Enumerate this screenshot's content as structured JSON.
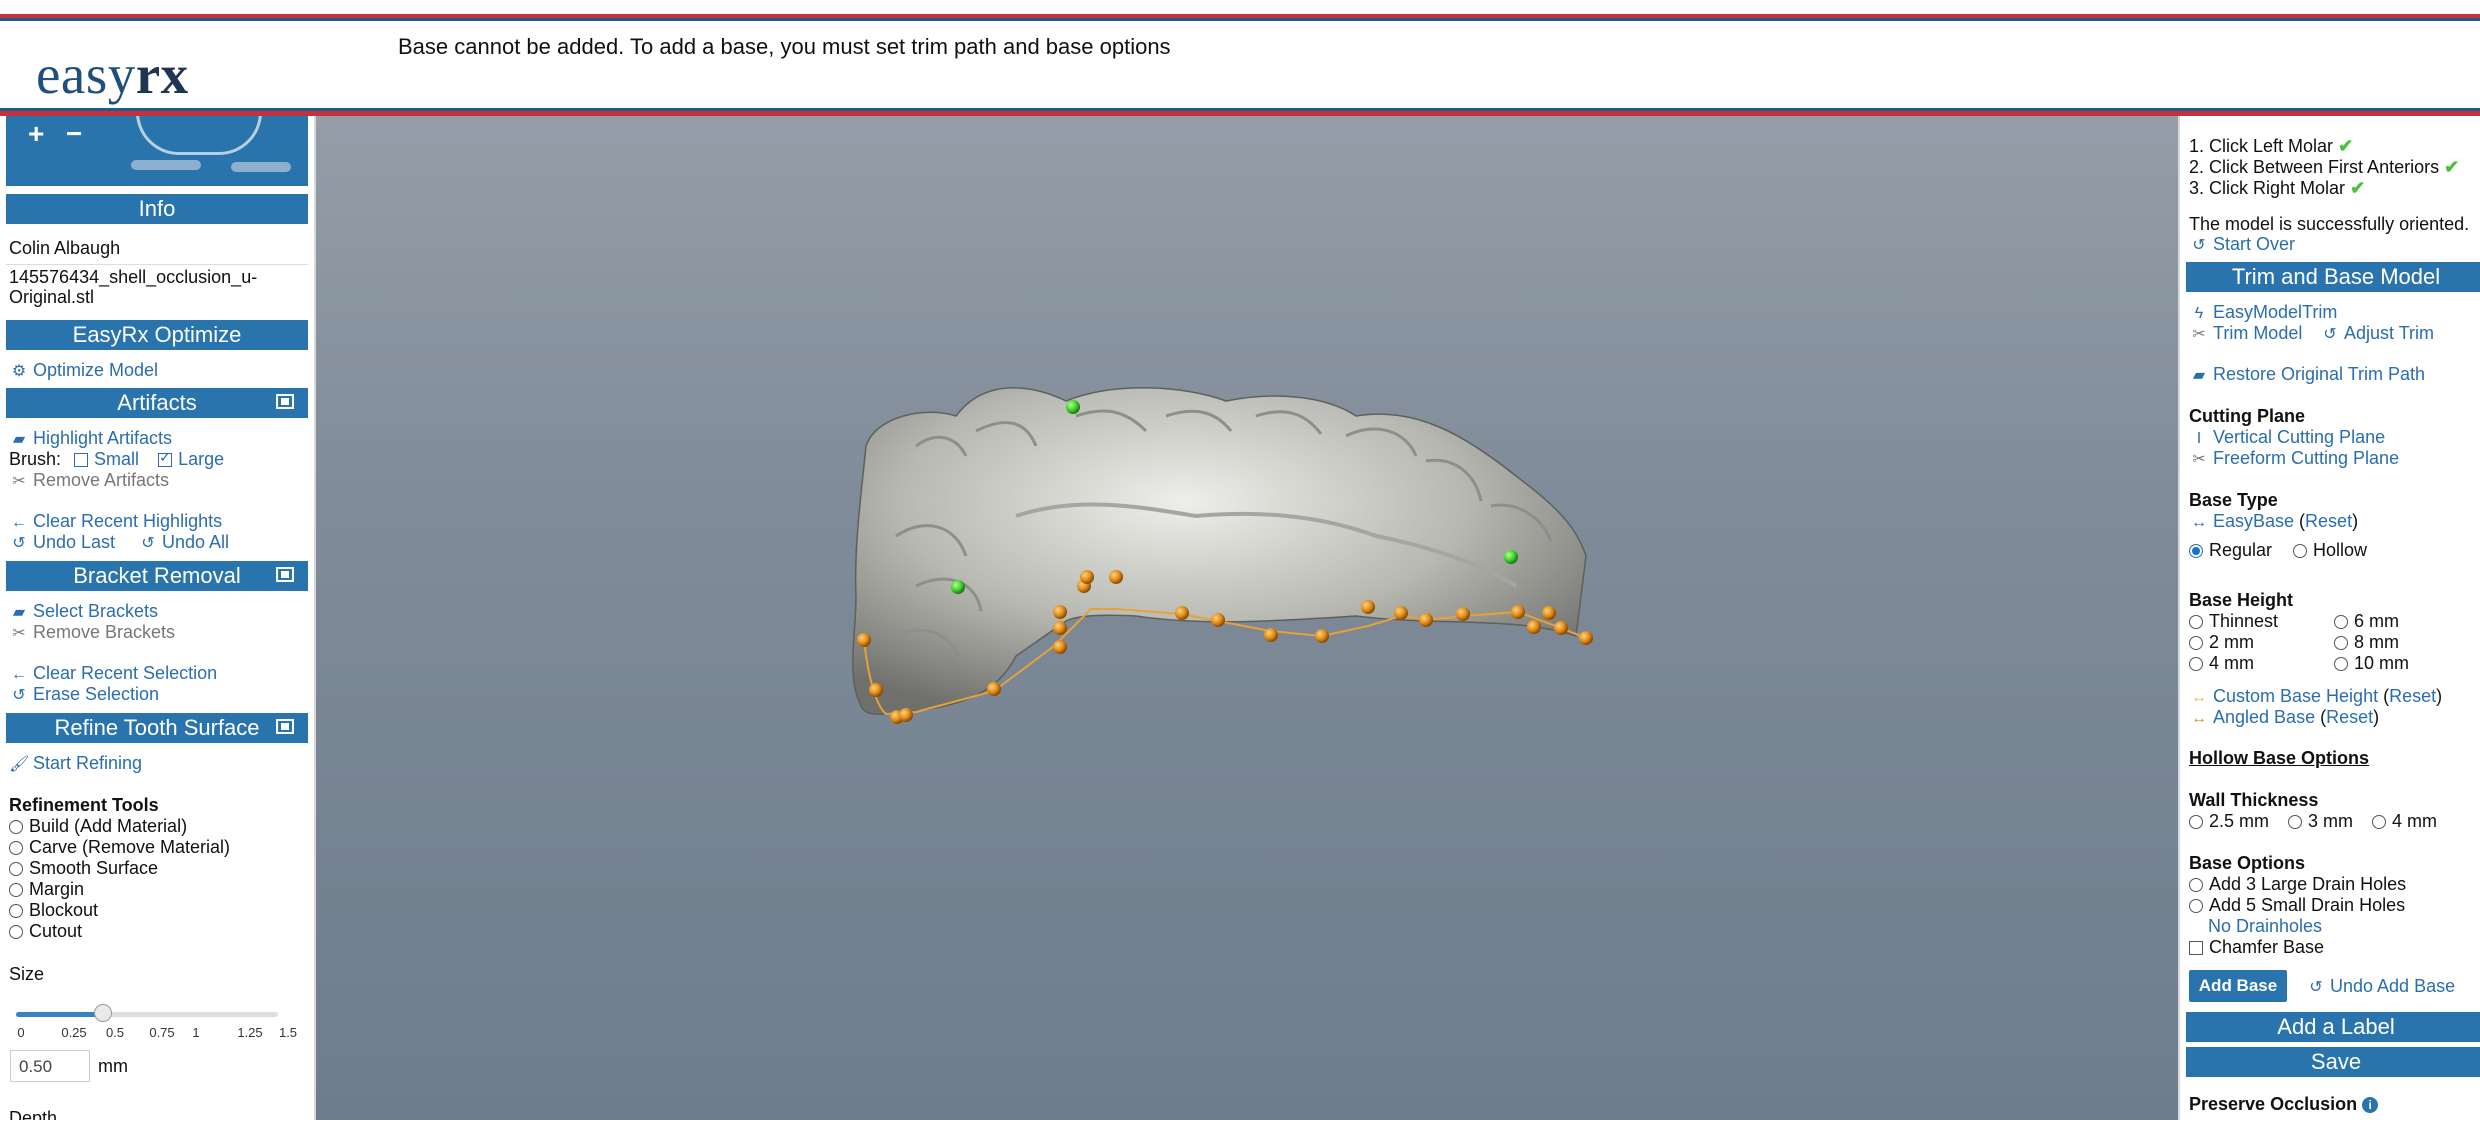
{
  "header": {
    "logo_easy": "easy",
    "logo_rx": "rx",
    "status_message": "Base cannot be added. To add a base, you must set trim path and base options"
  },
  "left": {
    "thumb_plus": "+",
    "thumb_minus": "−",
    "info_header": "Info",
    "patient_name": "Colin Albaugh",
    "file_name_line1": "145576434_shell_occlusion_u-",
    "file_name_line2": "Original.stl",
    "optimize_header": "EasyRx Optimize",
    "optimize_model": "Optimize Model",
    "artifacts_header": "Artifacts",
    "highlight_artifacts": "Highlight Artifacts",
    "brush_label": "Brush:",
    "brush_small": "Small",
    "brush_large": "Large",
    "remove_artifacts": "Remove Artifacts",
    "clear_recent_highlights": "Clear Recent Highlights",
    "undo_last": "Undo Last",
    "undo_all": "Undo All",
    "bracket_header": "Bracket Removal",
    "select_brackets": "Select Brackets",
    "remove_brackets": "Remove Brackets",
    "clear_recent_selection": "Clear Recent Selection",
    "erase_selection": "Erase Selection",
    "refine_header": "Refine Tooth Surface",
    "start_refining": "Start Refining",
    "refinement_tools_title": "Refinement Tools",
    "tools": [
      "Build (Add Material)",
      "Carve (Remove Material)",
      "Smooth Surface",
      "Margin",
      "Blockout",
      "Cutout"
    ],
    "size_label": "Size",
    "slider_ticks": [
      "0",
      "0.25",
      "0.5",
      "0.75",
      "1",
      "1.25",
      "1.5"
    ],
    "size_value": "0.50",
    "size_fraction": 0.3333,
    "size_unit": "mm",
    "depth_label": "Depth"
  },
  "right": {
    "step1": "1. Click Left Molar",
    "step2": "2. Click Between First Anteriors",
    "step3": "3. Click Right Molar",
    "oriented_msg": "The model is successfully oriented.",
    "start_over": "Start Over",
    "trim_header": "Trim and Base Model",
    "easy_model_trim": "EasyModelTrim",
    "trim_model": "Trim Model",
    "adjust_trim": "Adjust Trim",
    "restore_trim": "Restore Original Trim Path",
    "cutting_plane_title": "Cutting Plane",
    "vertical_cutting": "Vertical Cutting Plane",
    "freeform_cutting": "Freeform Cutting Plane",
    "base_type_title": "Base Type",
    "easybase": "EasyBase",
    "reset": "Reset",
    "regular": "Regular",
    "hollow": "Hollow",
    "base_height_title": "Base Height",
    "heights_left": [
      "Thinnest",
      "2 mm",
      "4 mm"
    ],
    "heights_right": [
      "6 mm",
      "8 mm",
      "10 mm"
    ],
    "custom_base_height": "Custom Base Height",
    "angled_base": "Angled Base",
    "hollow_options_title": "Hollow Base Options",
    "wall_thickness_title": "Wall Thickness",
    "walls": [
      "2.5 mm",
      "3 mm",
      "4 mm"
    ],
    "base_options_title": "Base Options",
    "drain3": "Add 3 Large Drain Holes",
    "drain5": "Add 5 Small Drain Holes",
    "no_drainholes": "No Drainholes",
    "chamfer": "Chamfer Base",
    "add_base": "Add Base",
    "undo_add_base": "Undo Add Base",
    "add_label": "Add a Label",
    "save": "Save",
    "preserve_occlusion": "Preserve Occlusion"
  },
  "colors": {
    "accent_blue": "#2a74ad",
    "header_red": "#c4323c",
    "link_blue": "#2a6db0",
    "viewport_gray": "#7f8b98",
    "trim_point_orange": "#e08a1a",
    "orient_point_green": "#3fcf2f"
  }
}
